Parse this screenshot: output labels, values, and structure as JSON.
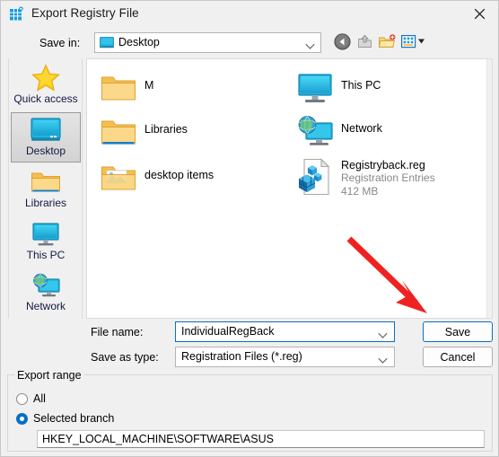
{
  "window": {
    "title": "Export Registry File",
    "app_icon": "registry-editor-icon",
    "close_label": "✕"
  },
  "toolbar": {
    "savein_label": "Save in:",
    "savein_value": "Desktop",
    "savein_icon": "desktop-monitor-icon",
    "buttons": [
      {
        "name": "back-button",
        "icon": "back-arrow-icon"
      },
      {
        "name": "up-one-level-button",
        "icon": "up-folder-icon"
      },
      {
        "name": "new-folder-button",
        "icon": "new-folder-icon"
      },
      {
        "name": "views-button",
        "icon": "views-grid-icon"
      }
    ]
  },
  "places": {
    "items": [
      {
        "label": "Quick access",
        "icon": "star-icon",
        "selected": false
      },
      {
        "label": "Desktop",
        "icon": "desktop-monitor-icon",
        "selected": true
      },
      {
        "label": "Libraries",
        "icon": "folder-icon",
        "selected": false
      },
      {
        "label": "This PC",
        "icon": "computer-icon",
        "selected": false
      },
      {
        "label": "Network",
        "icon": "network-globe-icon",
        "selected": false
      }
    ]
  },
  "file_list": {
    "column_left": [
      {
        "name": "M",
        "sub1": "",
        "sub2": "",
        "icon": "folder-icon"
      },
      {
        "name": "Libraries",
        "sub1": "",
        "sub2": "",
        "icon": "library-folder-icon"
      },
      {
        "name": "desktop items",
        "sub1": "",
        "sub2": "",
        "icon": "folder-pictures-icon"
      }
    ],
    "column_right": [
      {
        "name": "This PC",
        "sub1": "",
        "sub2": "",
        "icon": "computer-icon"
      },
      {
        "name": "Network",
        "sub1": "",
        "sub2": "",
        "icon": "network-globe-icon"
      },
      {
        "name": "Registryback.reg",
        "sub1": "Registration Entries",
        "sub2": "412 MB",
        "icon": "reg-file-icon"
      }
    ]
  },
  "form": {
    "filename_label": "File name:",
    "filename_value": "IndividualRegBack",
    "savetype_label": "Save as type:",
    "savetype_value": "Registration Files (*.reg)",
    "save_button": "Save",
    "cancel_button": "Cancel"
  },
  "export_range": {
    "legend": "Export range",
    "option_all": "All",
    "option_selected_branch": "Selected branch",
    "branch_value": "HKEY_LOCAL_MACHINE\\SOFTWARE\\ASUS",
    "selected": "Selected branch"
  },
  "annotation": {
    "arrow_color": "#f02121",
    "points_to": "save-button"
  }
}
